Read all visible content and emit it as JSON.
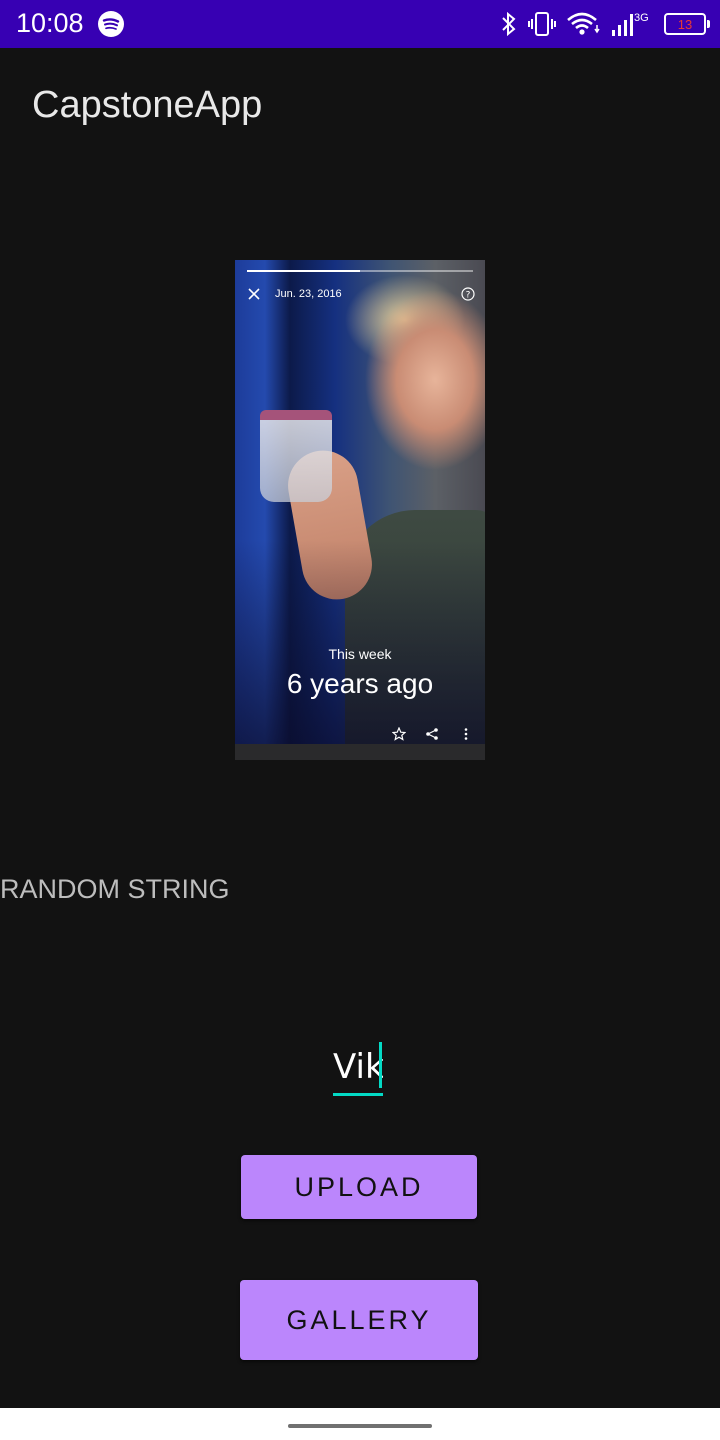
{
  "status_bar": {
    "time": "10:08",
    "network_label": "3G",
    "battery_level": "13",
    "icons": [
      "spotify-icon",
      "bluetooth-icon",
      "vibrate-icon",
      "wifi-icon",
      "signal-icon",
      "battery-icon"
    ]
  },
  "app_bar": {
    "title": "CapstoneApp"
  },
  "preview": {
    "date": "Jun. 23, 2016",
    "subtitle": "This week",
    "headline": "6 years ago",
    "story_progress": 0.5,
    "icons": [
      "close-icon",
      "help-icon",
      "star-icon",
      "share-icon",
      "more-vert-icon"
    ]
  },
  "random_string": "RANDOM STRING",
  "name_field": {
    "value": "Vik"
  },
  "buttons": {
    "upload": "UPLOAD",
    "gallery": "GALLERY"
  },
  "colors": {
    "status_bar": "#3700b3",
    "background": "#121212",
    "accent": "#03dac5",
    "button": "#bb86fc"
  }
}
